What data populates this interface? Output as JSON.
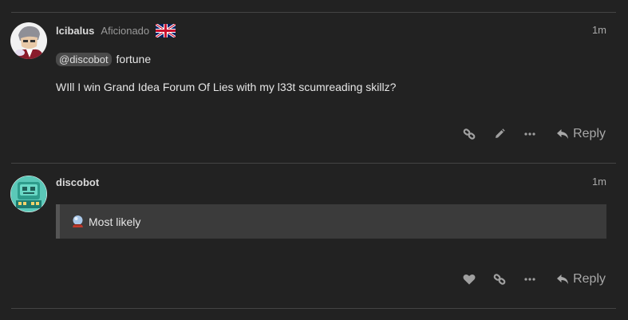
{
  "posts": [
    {
      "username": "lcibalus",
      "user_title": "Aficionado",
      "flag": "uk-flag-icon",
      "time": "1m",
      "mention": "@discobot",
      "text_after_mention": "fortune",
      "body": "WIll I win Grand Idea Forum Of Lies with my l33t scumreading skillz?",
      "actions": [
        "link-icon",
        "pencil-icon",
        "ellipsis-icon"
      ],
      "reply_label": "Reply"
    },
    {
      "username": "discobot",
      "time": "1m",
      "quote_icon": "crystal-ball-icon",
      "quote_text": "Most likely",
      "actions": [
        "heart-icon",
        "link-icon",
        "ellipsis-icon"
      ],
      "reply_label": "Reply"
    }
  ],
  "colors": {
    "background": "#222222",
    "divider": "#444444",
    "quote_background": "#3b3b3b",
    "quote_border": "#555555",
    "muted": "#a8a8a8"
  }
}
